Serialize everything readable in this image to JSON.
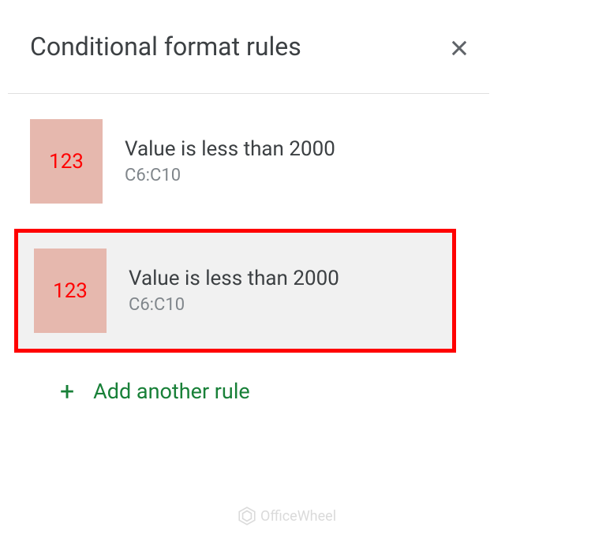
{
  "header": {
    "title": "Conditional format rules"
  },
  "rules": [
    {
      "preview_text": "123",
      "condition": "Value is less than 2000",
      "range": "C6:C10",
      "highlighted": false
    },
    {
      "preview_text": "123",
      "condition": "Value is less than 2000",
      "range": "C6:C10",
      "highlighted": true
    }
  ],
  "add_rule": {
    "label": "Add another rule"
  },
  "watermark": {
    "text": "OfficeWheel"
  },
  "colors": {
    "preview_bg": "#e6b8ae",
    "preview_text": "#ff0000",
    "accent_green": "#188038",
    "highlight_border": "#ff0000"
  }
}
